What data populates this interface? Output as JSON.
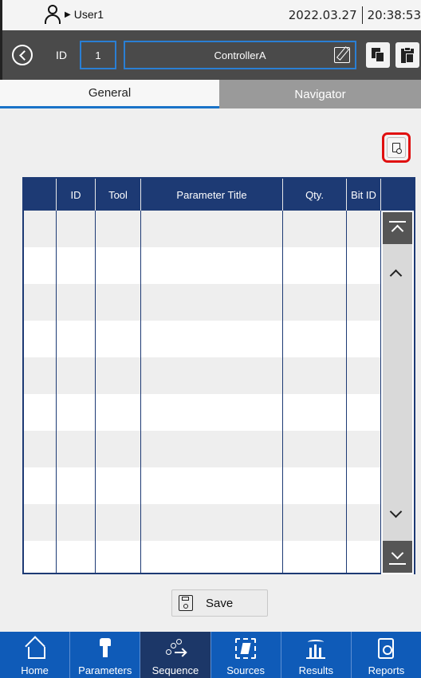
{
  "status_bar": {
    "user": "User1",
    "date": "2022.03.27",
    "time": "20:38:53"
  },
  "toolbar": {
    "id_label": "ID",
    "id_value": "1",
    "controller_name": "ControllerA"
  },
  "tabs": [
    {
      "label": "General",
      "active": true
    },
    {
      "label": "Navigator",
      "active": false
    }
  ],
  "table": {
    "columns": [
      "",
      "ID",
      "Tool",
      "Parameter Title",
      "Qty.",
      "Bit ID"
    ],
    "rows": []
  },
  "save_button": {
    "label": "Save"
  },
  "bottom_nav": [
    {
      "label": "Home",
      "icon": "home-icon"
    },
    {
      "label": "Parameters",
      "icon": "parameters-icon"
    },
    {
      "label": "Sequence",
      "icon": "sequence-icon",
      "active": true
    },
    {
      "label": "Sources",
      "icon": "sources-icon"
    },
    {
      "label": "Results",
      "icon": "results-icon"
    },
    {
      "label": "Reports",
      "icon": "reports-icon"
    }
  ],
  "colors": {
    "header_dark": "#4a4a4a",
    "table_header": "#1d3a74",
    "accent_blue": "#1a73c8",
    "nav_blue": "#0f5bb8",
    "nav_active": "#1c3768",
    "highlight_red": "#e01010"
  }
}
